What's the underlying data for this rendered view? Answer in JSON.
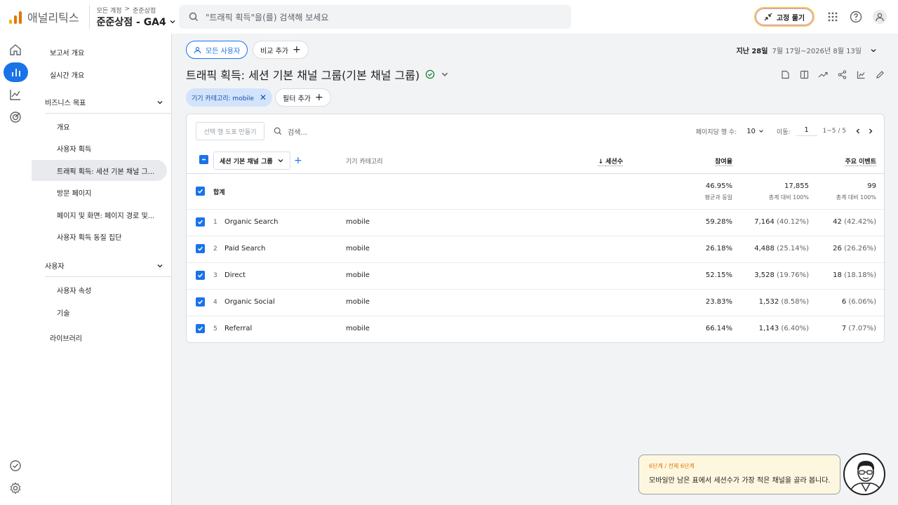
{
  "header": {
    "app_name": "애널리틱스",
    "crumb_all": "모든 계정",
    "crumb_sep": ">",
    "crumb_account": "준준상점",
    "property": "준준상점 - GA4",
    "search_placeholder": "\"트래픽 획득\"을(를) 검색해 보세요",
    "pin_label": "고정 풀기",
    "icons": [
      "apps-icon",
      "help-icon",
      "account-icon"
    ]
  },
  "rail": {
    "icons": [
      "home-icon",
      "reports-icon",
      "explore-icon",
      "advertising-icon",
      "admin-check-icon",
      "settings-icon"
    ]
  },
  "sidebar": {
    "report_overview": "보고서 개요",
    "realtime": "실시간 개요",
    "section_business": "비즈니스 목표",
    "items_business": [
      "개요",
      "사용자 획득",
      "트래픽 획득: 세션 기본 채널 그...",
      "방문 페이지",
      "페이지 및 화면: 페이지 경로 및...",
      "사용자 획득 동질 집단"
    ],
    "section_user": "사용자",
    "items_user": [
      "사용자 속성",
      "기술"
    ],
    "library": "라이브러리"
  },
  "main": {
    "segment_chip": "모든 사용자",
    "compare_chip": "비교 추가",
    "date_label": "지난 28일",
    "date_range": "7월 17일~2026년 8월 13일",
    "title": "트래픽 획득: 세션 기본 채널 그룹(기본 채널 그룹)",
    "filter_chip": "기기 카테고리: mobile",
    "filter_add": "필터 추가"
  },
  "table": {
    "make_btn": "선택 행 도표 만들기",
    "search_placeholder": "검색...",
    "rows_per_page_label": "페이지당 행 수:",
    "rows_per_page": "10",
    "goto_label": "이동:",
    "goto_value": "1",
    "range": "1~5 / 5",
    "dim1": "세션 기본 채널 그룹",
    "dim2": "기기 카테고리",
    "col_sessions": "세션수",
    "col_engagement": "참여율",
    "col_key_events": "주요 이벤트",
    "total": {
      "label": "합계",
      "sessions": "17,855",
      "sessions_sub": "총계 대비 100%",
      "engagement": "46.95%",
      "engagement_sub": "평균과 동일",
      "key_events": "99",
      "key_events_sub": "총계 대비 100%"
    },
    "rows": [
      {
        "idx": "1",
        "channel": "Organic Search",
        "device": "mobile",
        "sessions": "7,164",
        "sessions_pct": "(40.12%)",
        "engagement": "59.28%",
        "key_events": "42",
        "key_events_pct": "(42.42%)"
      },
      {
        "idx": "2",
        "channel": "Paid Search",
        "device": "mobile",
        "sessions": "4,488",
        "sessions_pct": "(25.14%)",
        "engagement": "26.18%",
        "key_events": "26",
        "key_events_pct": "(26.26%)"
      },
      {
        "idx": "3",
        "channel": "Direct",
        "device": "mobile",
        "sessions": "3,528",
        "sessions_pct": "(19.76%)",
        "engagement": "52.15%",
        "key_events": "18",
        "key_events_pct": "(18.18%)"
      },
      {
        "idx": "4",
        "channel": "Organic Social",
        "device": "mobile",
        "sessions": "1,532",
        "sessions_pct": "(8.58%)",
        "engagement": "23.83%",
        "key_events": "6",
        "key_events_pct": "(6.06%)"
      },
      {
        "idx": "5",
        "channel": "Referral",
        "device": "mobile",
        "sessions": "1,143",
        "sessions_pct": "(6.40%)",
        "engagement": "66.14%",
        "key_events": "7",
        "key_events_pct": "(7.07%)"
      }
    ]
  },
  "tutorial": {
    "step": "6단계 / 전체 6단계",
    "text": "모바일만 남은 표에서 세션수가 가장 적은 채널을 골라 봅니다."
  },
  "colors": {
    "accent": "#1a73e8",
    "orange": "#e37400",
    "tip_bg": "#fef7e0"
  }
}
